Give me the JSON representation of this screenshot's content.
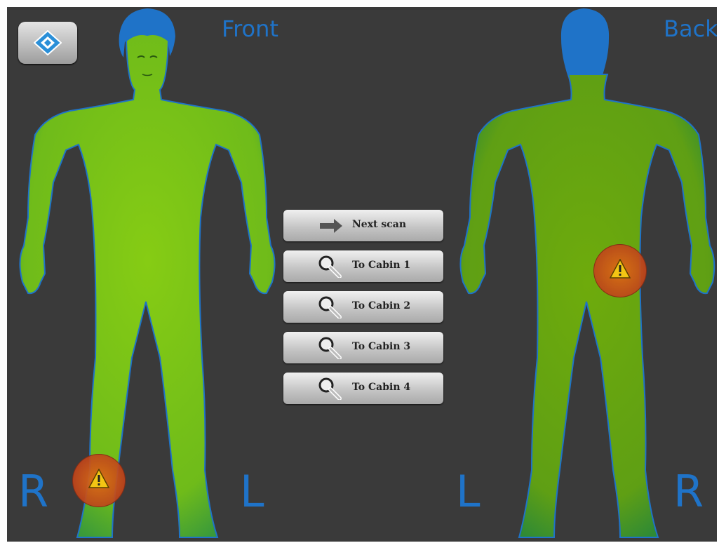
{
  "header": {
    "logo_icon": "rohde-schwarz-diamond-logo",
    "front_label": "Front",
    "back_label": "Back"
  },
  "front_view": {
    "left_marker": "R",
    "right_marker": "L",
    "alert_icon": "warning-triangle-icon"
  },
  "back_view": {
    "left_marker": "L",
    "right_marker": "R",
    "alert_icon": "warning-triangle-icon"
  },
  "menu": {
    "items": [
      {
        "label": "Next scan",
        "icon": "arrow-right-icon"
      },
      {
        "label": "To Cabin 1",
        "icon": "magnifier-icon"
      },
      {
        "label": "To Cabin 2",
        "icon": "magnifier-icon"
      },
      {
        "label": "To Cabin 3",
        "icon": "magnifier-icon"
      },
      {
        "label": "To Cabin 4",
        "icon": "magnifier-icon"
      }
    ]
  },
  "colors": {
    "background": "#3a3a3a",
    "body_fill": "#7fc71a",
    "outline_blue": "#1f73c8",
    "alert_orange": "#d2661c"
  }
}
